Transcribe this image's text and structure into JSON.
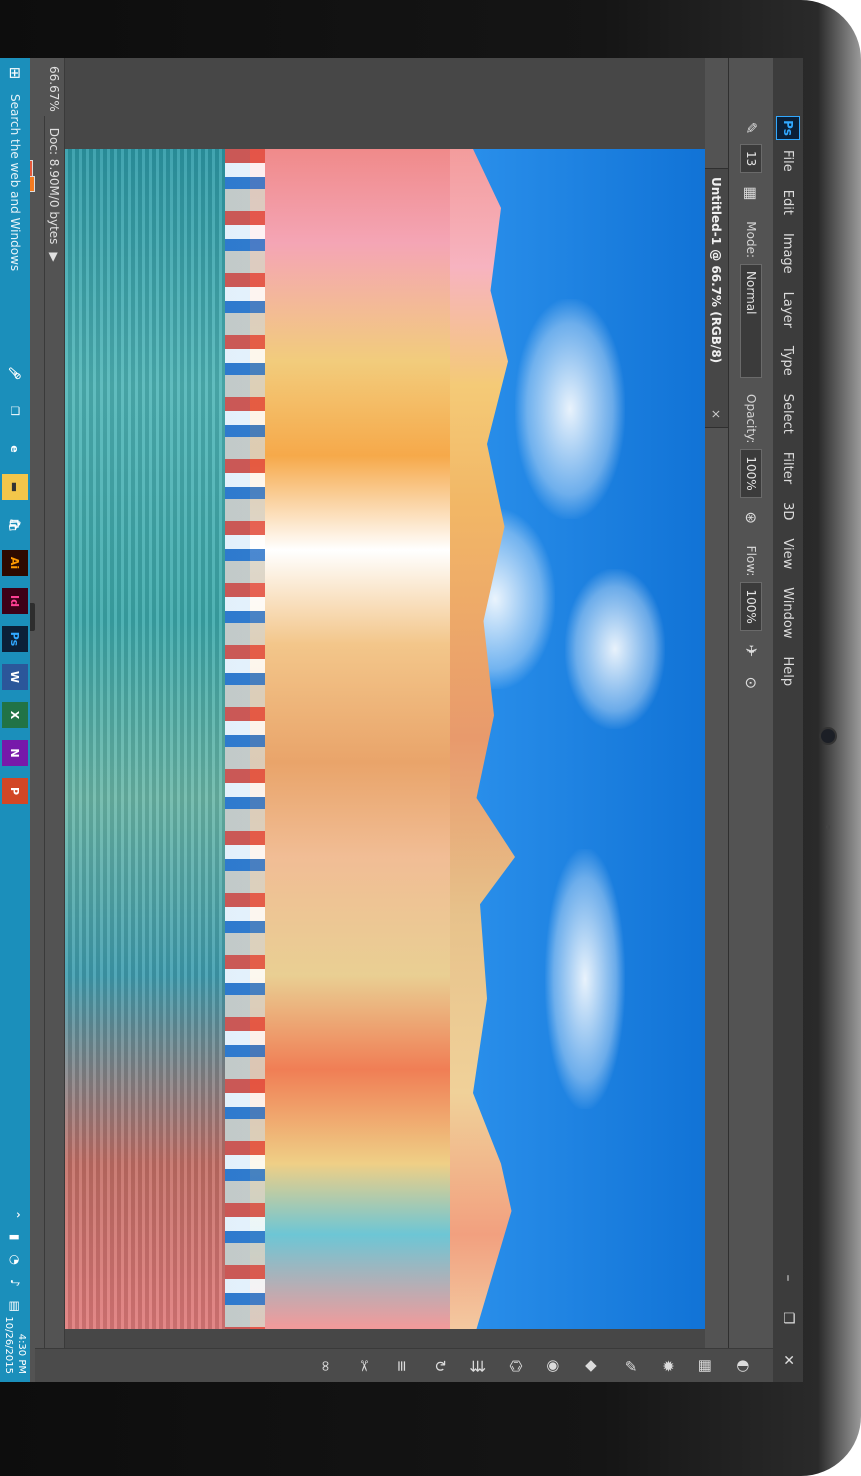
{
  "app": {
    "logo": "Ps",
    "name": "Photoshop"
  },
  "menu": [
    "File",
    "Edit",
    "Image",
    "Layer",
    "Type",
    "Select",
    "Filter",
    "3D",
    "View",
    "Window",
    "Help"
  ],
  "window_controls": {
    "minimize": "–",
    "restore": "❐",
    "close": "✕"
  },
  "options": {
    "brush_size": "13",
    "mode_label": "Mode:",
    "mode_value": "Normal",
    "opacity_label": "Opacity:",
    "opacity_value": "100%",
    "flow_label": "Flow:",
    "flow_value": "100%"
  },
  "document": {
    "tab_title": "Untitled-1 @ 66.7% (RGB/8)",
    "close": "×"
  },
  "status": {
    "zoom": "66.67%",
    "doc_info": "Doc: 8.90M/0 bytes"
  },
  "colors": {
    "foreground": "#e65a3b",
    "background": "#f47b20",
    "accent": "#31a8ff",
    "taskbar": "#1b8fbb"
  },
  "tools": [
    "marquee-icon",
    "lasso-icon",
    "quick-select-icon",
    "crop-icon",
    "eyedropper-icon",
    "healing-brush-icon",
    "brush-icon",
    "clone-stamp-icon",
    "history-brush-icon",
    "eraser-icon",
    "gradient-icon",
    "blur-icon",
    "dodge-icon",
    "pen-icon",
    "type-icon",
    "path-select-icon",
    "rectangle-icon",
    "hand-icon",
    "zoom-icon"
  ],
  "panel_icons": [
    "color-wheel-icon",
    "swatches-icon",
    "adjustments-icon",
    "brush-presets-icon",
    "shapes-icon",
    "layers-icon",
    "paths-icon",
    "history-icon",
    "properties-icon",
    "character-icon",
    "tools-icon",
    "libraries-icon"
  ],
  "taskbar": {
    "search_placeholder": "Search the web and Windows",
    "apps": [
      "Ai",
      "Id",
      "Ps",
      "W",
      "X",
      "N",
      "P"
    ],
    "time": "4:30 PM",
    "date": "10/26/2015"
  }
}
